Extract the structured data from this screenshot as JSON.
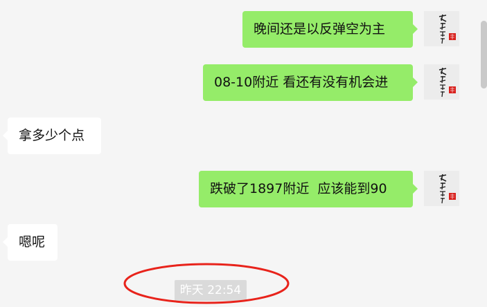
{
  "messages": [
    {
      "side": "sent",
      "text": "晚间还是以反弹空为主"
    },
    {
      "side": "sent",
      "text": "08-10附近 看还有没有机会进"
    },
    {
      "side": "received",
      "text": "拿多少个点"
    },
    {
      "side": "sent",
      "text": "跌破了1897附近  应该能到90"
    },
    {
      "side": "received",
      "text": "嗯呢"
    }
  ],
  "timestamp": "昨天 22:54",
  "colors": {
    "background": "#f5f5f5",
    "sent_bubble": "#95ec69",
    "received_bubble": "#ffffff",
    "timestamp_bg": "#dadada",
    "annotation_circle": "#e8231b"
  },
  "icons": {
    "avatar": "calligraphy-avatar-with-red-seal"
  }
}
